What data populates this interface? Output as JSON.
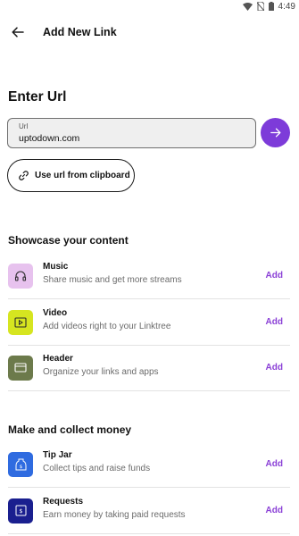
{
  "status_bar": {
    "time": "4:49",
    "icons": [
      "wifi-icon",
      "no-sim-icon",
      "battery-icon"
    ]
  },
  "app_bar": {
    "title": "Add New Link",
    "back_icon": "arrow-left-icon"
  },
  "enter_url": {
    "heading": "Enter Url",
    "field_label": "Url",
    "field_value": "uptodown.com",
    "go_icon": "arrow-right-icon",
    "clipboard_label": "Use url from clipboard"
  },
  "showcase": {
    "heading": "Showcase your content",
    "items": [
      {
        "title": "Music",
        "subtitle": "Share music and get more streams",
        "action": "Add",
        "icon": "headphones-icon",
        "icon_bg": "#e7c2ee"
      },
      {
        "title": "Video",
        "subtitle": "Add videos right to your Linktree",
        "action": "Add",
        "icon": "video-icon",
        "icon_bg": "#d6e520"
      },
      {
        "title": "Header",
        "subtitle": "Organize your links and apps",
        "action": "Add",
        "icon": "header-icon",
        "icon_bg": "#6c7a4b"
      }
    ]
  },
  "money": {
    "heading": "Make and collect money",
    "items": [
      {
        "title": "Tip Jar",
        "subtitle": "Collect tips and raise funds",
        "action": "Add",
        "icon": "tip-jar-icon",
        "icon_bg": "#2f6be0"
      },
      {
        "title": "Requests",
        "subtitle": "Earn money by taking paid requests",
        "action": "Add",
        "icon": "requests-icon",
        "icon_bg": "#1a1f8f"
      }
    ]
  },
  "colors": {
    "accent": "#7d3bd9",
    "add_text": "#8a3fd6",
    "field_bg": "#efefef"
  }
}
